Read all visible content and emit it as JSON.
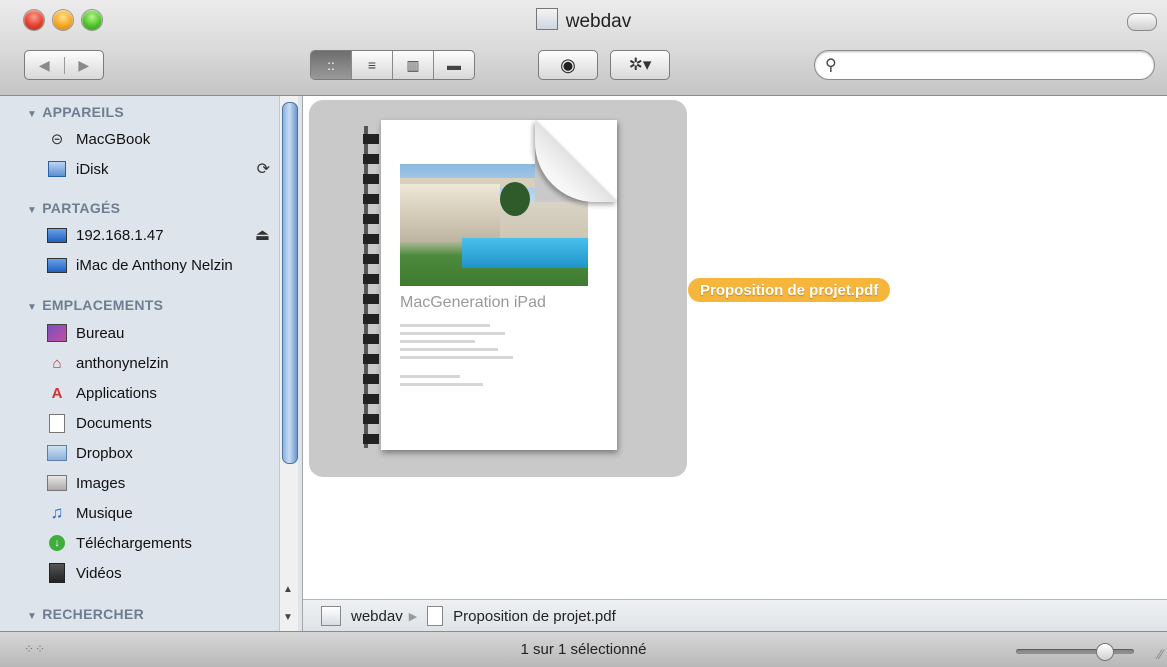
{
  "window": {
    "title": "webdav"
  },
  "toolbar": {
    "back_icon": "◀",
    "forward_icon": "▶",
    "view_icons": "icon-view",
    "views": [
      "::",
      "≡",
      "▥",
      "▬"
    ],
    "quicklook_glyph": "◉",
    "action_glyph": "✲▾",
    "search_glyph": "⚲",
    "search_value": "",
    "search_placeholder": ""
  },
  "sidebar": {
    "sections": [
      {
        "title": "APPAREILS",
        "items": [
          {
            "label": "MacGBook",
            "icon": "laptop-icon"
          },
          {
            "label": "iDisk",
            "icon": "idisk-icon",
            "right": "⟳"
          }
        ]
      },
      {
        "title": "PARTAGÉS",
        "items": [
          {
            "label": "192.168.1.47",
            "icon": "server-icon",
            "right": "⏏"
          },
          {
            "label": "iMac de Anthony Nelzin",
            "icon": "imac-icon"
          }
        ]
      },
      {
        "title": "EMPLACEMENTS",
        "items": [
          {
            "label": "Bureau",
            "icon": "desktop-icon"
          },
          {
            "label": "anthonynelzin",
            "icon": "home-icon"
          },
          {
            "label": "Applications",
            "icon": "applications-icon"
          },
          {
            "label": "Documents",
            "icon": "documents-icon"
          },
          {
            "label": "Dropbox",
            "icon": "dropbox-folder-icon"
          },
          {
            "label": "Images",
            "icon": "images-icon"
          },
          {
            "label": "Musique",
            "icon": "music-icon"
          },
          {
            "label": "Téléchargements",
            "icon": "downloads-icon"
          },
          {
            "label": "Vidéos",
            "icon": "videos-icon"
          }
        ]
      },
      {
        "title": "RECHERCHER",
        "items": []
      }
    ]
  },
  "content": {
    "file": {
      "name": "Proposition de projet.pdf",
      "preview_heading": "MacGeneration iPad"
    }
  },
  "pathbar": {
    "segments": [
      "webdav",
      "Proposition de projet.pdf"
    ]
  },
  "status": {
    "text": "1 sur 1 sélectionné",
    "icon_size_fraction": 0.75
  },
  "colors": {
    "selection_label": "#f6b53b",
    "sidebar_bg": "#dde4ec",
    "section_header": "#6e7e90"
  }
}
